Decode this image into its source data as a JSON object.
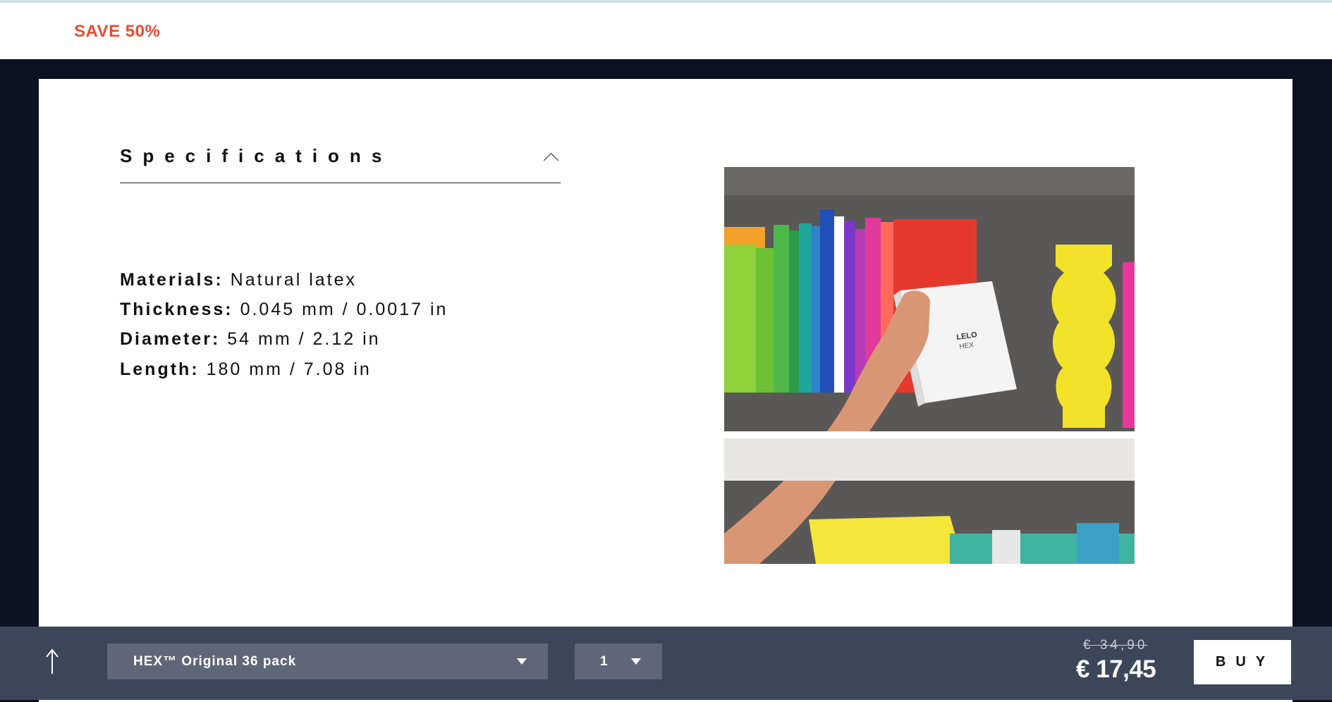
{
  "promo": {
    "text": "SAVE 50%"
  },
  "specifications": {
    "title": "Specifications",
    "rows": [
      {
        "key": "Materials:",
        "value": "Natural latex"
      },
      {
        "key": "Thickness:",
        "value": "0.045 mm / 0.0017 in"
      },
      {
        "key": "Diameter:",
        "value": "54 mm / 2.12 in"
      },
      {
        "key": "Length:",
        "value": "180 mm / 7.08 in"
      }
    ]
  },
  "photo": {
    "box_brand": "LELO",
    "box_name": "HEX"
  },
  "buy_bar": {
    "variant": "HEX™ Original 36 pack",
    "quantity": "1",
    "old_price": "€ 34,90",
    "price": "€ 17,45",
    "buy_label": "BUY"
  },
  "colors": {
    "promo": "#f04a2e",
    "frame": "#0b1222",
    "bar": "#3c4659",
    "select": "#5e6677"
  }
}
